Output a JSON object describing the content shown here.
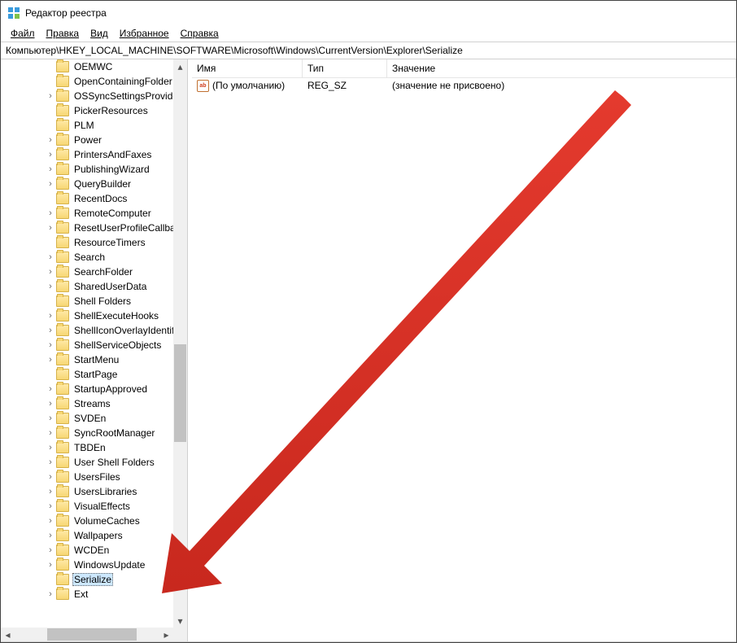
{
  "window": {
    "title": "Редактор реестра"
  },
  "menu": {
    "file": "Файл",
    "edit": "Правка",
    "view": "Вид",
    "favorites": "Избранное",
    "help": "Справка"
  },
  "path": "Компьютер\\HKEY_LOCAL_MACHINE\\SOFTWARE\\Microsoft\\Windows\\CurrentVersion\\Explorer\\Serialize",
  "tree": [
    {
      "exp": "blank",
      "label": "OEMWC"
    },
    {
      "exp": "blank",
      "label": "OpenContainingFolder"
    },
    {
      "exp": ">",
      "label": "OSSyncSettingsProviders"
    },
    {
      "exp": "blank",
      "label": "PickerResources"
    },
    {
      "exp": "blank",
      "label": "PLM"
    },
    {
      "exp": ">",
      "label": "Power"
    },
    {
      "exp": ">",
      "label": "PrintersAndFaxes"
    },
    {
      "exp": ">",
      "label": "PublishingWizard"
    },
    {
      "exp": ">",
      "label": "QueryBuilder"
    },
    {
      "exp": "blank",
      "label": "RecentDocs"
    },
    {
      "exp": ">",
      "label": "RemoteComputer"
    },
    {
      "exp": ">",
      "label": "ResetUserProfileCallbacks"
    },
    {
      "exp": "blank",
      "label": "ResourceTimers"
    },
    {
      "exp": ">",
      "label": "Search"
    },
    {
      "exp": ">",
      "label": "SearchFolder"
    },
    {
      "exp": ">",
      "label": "SharedUserData"
    },
    {
      "exp": "blank",
      "label": "Shell Folders"
    },
    {
      "exp": ">",
      "label": "ShellExecuteHooks"
    },
    {
      "exp": ">",
      "label": "ShellIconOverlayIdentifiers"
    },
    {
      "exp": ">",
      "label": "ShellServiceObjects"
    },
    {
      "exp": ">",
      "label": "StartMenu"
    },
    {
      "exp": "blank",
      "label": "StartPage"
    },
    {
      "exp": ">",
      "label": "StartupApproved"
    },
    {
      "exp": ">",
      "label": "Streams"
    },
    {
      "exp": ">",
      "label": "SVDEn"
    },
    {
      "exp": ">",
      "label": "SyncRootManager"
    },
    {
      "exp": ">",
      "label": "TBDEn"
    },
    {
      "exp": ">",
      "label": "User Shell Folders"
    },
    {
      "exp": ">",
      "label": "UsersFiles"
    },
    {
      "exp": ">",
      "label": "UsersLibraries"
    },
    {
      "exp": ">",
      "label": "VisualEffects"
    },
    {
      "exp": ">",
      "label": "VolumeCaches"
    },
    {
      "exp": ">",
      "label": "Wallpapers"
    },
    {
      "exp": ">",
      "label": "WCDEn"
    },
    {
      "exp": ">",
      "label": "WindowsUpdate"
    },
    {
      "exp": "blank",
      "label": "Serialize",
      "selected": true
    },
    {
      "exp": ">",
      "label": "Ext"
    }
  ],
  "columns": {
    "name": "Имя",
    "type": "Тип",
    "value": "Значение"
  },
  "values": [
    {
      "name": "(По умолчанию)",
      "type": "REG_SZ",
      "value": "(значение не присвоено)"
    }
  ]
}
